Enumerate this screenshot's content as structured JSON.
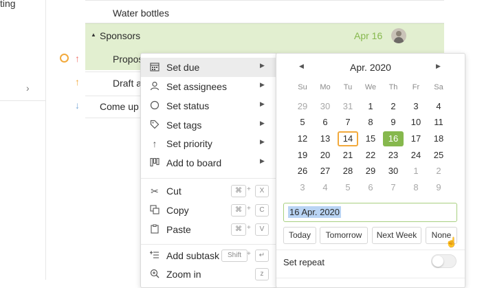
{
  "sidebar": {
    "cut_text": "ting"
  },
  "tasks": {
    "water_bottles": "Water bottles",
    "sponsors": "Sponsors",
    "sponsors_date": "Apr 16",
    "proposal": "Propos",
    "draft": "Draft a",
    "come_up": "Come up w"
  },
  "colors": {
    "accent_green": "#86b84d",
    "row_highlight": "#e2efd0",
    "today_outline": "#f2a93b",
    "priority_high": "#f0736b",
    "priority_medium": "#f2a93b",
    "priority_low": "#7aa8d6"
  },
  "menu": {
    "items": [
      {
        "label": "Set due",
        "icon": "calendar-icon"
      },
      {
        "label": "Set assignees",
        "icon": "person-icon"
      },
      {
        "label": "Set status",
        "icon": "circle-icon"
      },
      {
        "label": "Set tags",
        "icon": "tag-icon"
      },
      {
        "label": "Set priority",
        "icon": "arrow-up-icon"
      },
      {
        "label": "Add to board",
        "icon": "board-icon"
      }
    ],
    "cut": "Cut",
    "copy": "Copy",
    "paste": "Paste",
    "add_subtask": "Add subtask",
    "zoom_in": "Zoom in",
    "cmd": "⌘",
    "plus": "+",
    "cut_key": "X",
    "copy_key": "C",
    "paste_key": "V",
    "shift_key": "Shift",
    "enter_key": "↵",
    "zoom_key": "z"
  },
  "picker": {
    "month": "Apr. 2020",
    "weekdays": [
      "Su",
      "Mo",
      "Tu",
      "We",
      "Th",
      "Fr",
      "Sa"
    ],
    "weeks": [
      [
        "29",
        "30",
        "31",
        "1",
        "2",
        "3",
        "4"
      ],
      [
        "5",
        "6",
        "7",
        "8",
        "9",
        "10",
        "11"
      ],
      [
        "12",
        "13",
        "14",
        "15",
        "16",
        "17",
        "18"
      ],
      [
        "19",
        "20",
        "21",
        "22",
        "23",
        "24",
        "25"
      ],
      [
        "26",
        "27",
        "28",
        "29",
        "30",
        "1",
        "2"
      ],
      [
        "3",
        "4",
        "5",
        "6",
        "7",
        "8",
        "9"
      ]
    ],
    "today": "14",
    "selected": "16",
    "input_value": "16 Apr. 2020",
    "quick": [
      "Today",
      "Tomorrow",
      "Next Week",
      "None"
    ],
    "repeat_label": "Set repeat",
    "repeat_on": false
  }
}
